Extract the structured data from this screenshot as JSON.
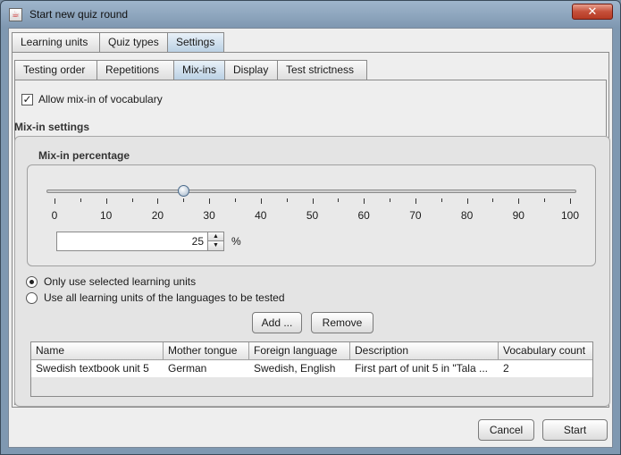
{
  "window": {
    "title": "Start new quiz round",
    "close_symbol": "✕"
  },
  "tabs_top": [
    {
      "label": "Learning units"
    },
    {
      "label": "Quiz types"
    },
    {
      "label": "Settings",
      "active": true
    }
  ],
  "tabs_sub": [
    {
      "label": "Testing order"
    },
    {
      "label": "Repetitions"
    },
    {
      "label": "Mix-ins",
      "active": true
    },
    {
      "label": "Display"
    },
    {
      "label": "Test strictness"
    }
  ],
  "mixin": {
    "allow_label": "Allow mix-in of vocabulary",
    "allow_checked": true,
    "settings_title": "Mix-in settings",
    "percentage_title": "Mix-in percentage",
    "slider": {
      "min": 0,
      "max": 100,
      "value": 25
    },
    "tick_labels": [
      "0",
      "10",
      "20",
      "30",
      "40",
      "50",
      "60",
      "70",
      "80",
      "90",
      "100"
    ],
    "spinner_value": "25",
    "unit": "%",
    "radio_selected_label": "Only use selected learning units",
    "radio_all_label": "Use all learning units of the languages to be tested",
    "add_label": "Add ...",
    "remove_label": "Remove"
  },
  "table": {
    "columns": [
      "Name",
      "Mother tongue",
      "Foreign language",
      "Description",
      "Vocabulary count"
    ],
    "rows": [
      [
        "Swedish textbook unit 5",
        "German",
        "Swedish, English",
        "First part of unit 5 in \"Tala ...",
        "2"
      ]
    ]
  },
  "footer": {
    "cancel_label": "Cancel",
    "start_label": "Start"
  }
}
